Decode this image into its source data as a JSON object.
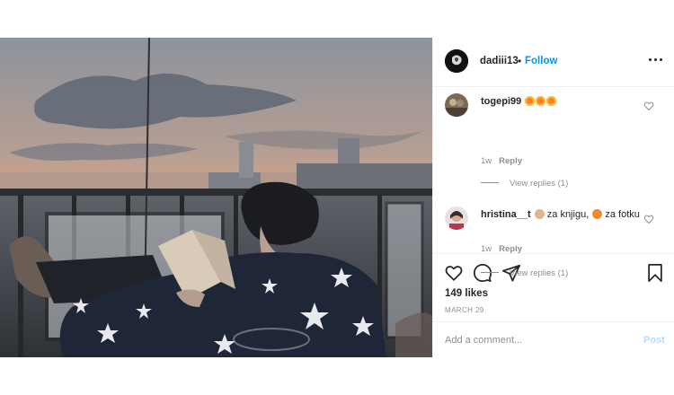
{
  "header": {
    "username": "dadiii13",
    "separator": "•",
    "follow_label": "Follow",
    "more_icon": "more-options-icon"
  },
  "comments": [
    {
      "username": "togepi99",
      "text": "",
      "emojis": [
        "heart-eyes-emoji",
        "heart-eyes-emoji",
        "heart-eyes-emoji"
      ],
      "age": "1w",
      "reply_label": "Reply",
      "view_replies": "View replies (1)"
    },
    {
      "username": "hristina__t",
      "text_part1": "za knjigu,",
      "text_part2": "za fotku",
      "emojis": [
        "clapping-hands-emoji",
        "fox-emoji"
      ],
      "age": "1w",
      "reply_label": "Reply",
      "view_replies": "View replies (1)"
    }
  ],
  "actions": {
    "like_icon": "heart-icon",
    "comment_icon": "comment-icon",
    "share_icon": "share-icon",
    "save_icon": "bookmark-icon"
  },
  "likes": "149 likes",
  "date": "MARCH 29",
  "add_comment": {
    "placeholder": "Add a comment...",
    "post_label": "Post"
  },
  "colors": {
    "follow_blue": "#0095f6",
    "post_disabled": "#b3dbff",
    "text": "#262626",
    "muted": "#8e8e8e",
    "divider": "#efefef"
  }
}
